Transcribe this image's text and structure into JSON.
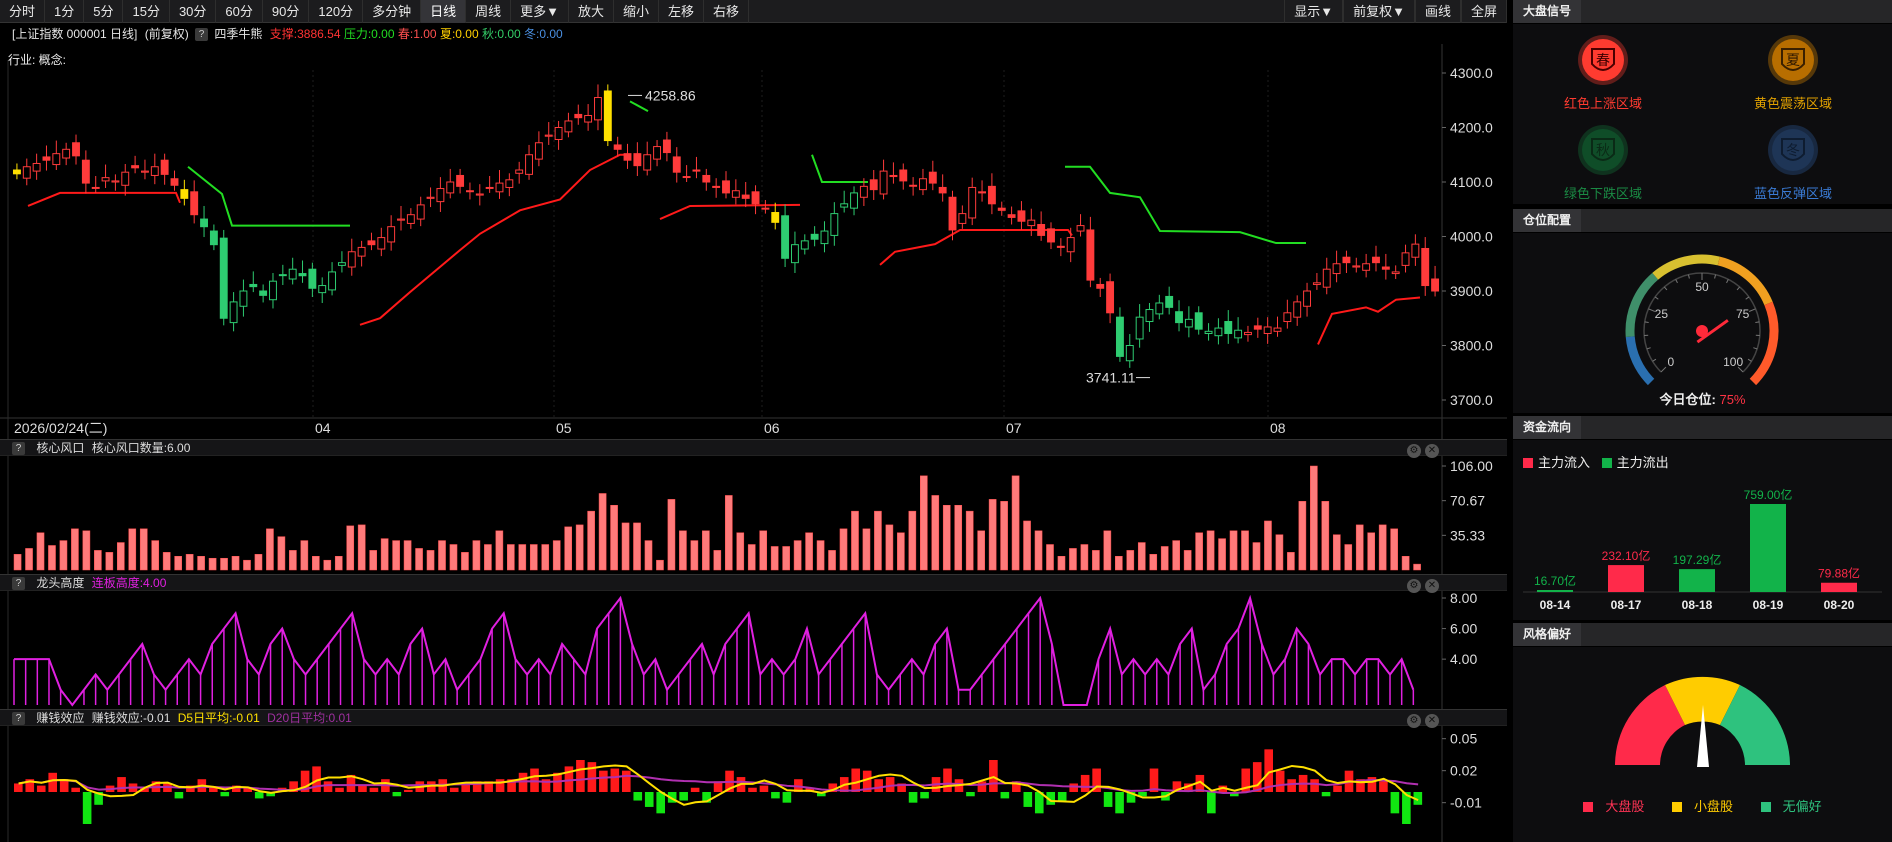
{
  "toolbar": {
    "left": [
      "分时",
      "1分",
      "5分",
      "15分",
      "30分",
      "60分",
      "90分",
      "120分",
      "多分钟",
      "日线",
      "周线",
      "更多▼",
      "放大",
      "缩小",
      "左移",
      "右移"
    ],
    "active_index": 9,
    "right": [
      "显示▼",
      "前复权▼",
      "画线",
      "全屏"
    ]
  },
  "info": {
    "instrument": "[上证指数 000001 日线]",
    "adjust": "(前复权)",
    "help": "?",
    "indicator": "四季牛熊",
    "support": "支撑:3886.54",
    "pressure": "压力:0.00",
    "spring": "春:1.00",
    "summer": "夏:0.00",
    "autumn": "秋:0.00",
    "winter": "冬:0.00",
    "industry": "行业: 概念:"
  },
  "main_chart": {
    "y_ticks": [
      "4300.0",
      "4200.0",
      "4100.0",
      "4000.0",
      "3900.0",
      "3800.0",
      "3700.0"
    ],
    "x_labels": [
      "2026/02/24(二)",
      "04",
      "05",
      "06",
      "07",
      "08"
    ],
    "high_label": "4258.86",
    "low_label": "3741.11"
  },
  "panels": {
    "core": {
      "title": "核心风口",
      "value": "核心风口数量:6.00",
      "ticks": [
        "106.00",
        "70.67",
        "35.33"
      ]
    },
    "dragon": {
      "title": "龙头高度",
      "value": "连板高度:4.00",
      "ticks": [
        "8.00",
        "6.00",
        "4.00"
      ]
    },
    "money": {
      "title": "赚钱效应",
      "value": "赚钱效应:-0.01",
      "d5": "D5日平均:-0.01",
      "d20": "D20日平均:0.01",
      "ticks": [
        "0.05",
        "0.02",
        "-0.01"
      ]
    }
  },
  "sidebar": {
    "market_signal": {
      "title": "大盘信号",
      "items": [
        {
          "glyph": "春",
          "label": "红色上涨区域",
          "color": "#ff3b30"
        },
        {
          "glyph": "夏",
          "label": "黄色震荡区域",
          "color": "#e08a00"
        },
        {
          "glyph": "秋",
          "label": "绿色下跌区域",
          "color": "#17a34a"
        },
        {
          "glyph": "冬",
          "label": "蓝色反弹区域",
          "color": "#3a7bd5"
        }
      ]
    },
    "position": {
      "title": "仓位配置",
      "ticks": [
        "0",
        "25",
        "50",
        "75",
        "100"
      ],
      "label": "今日仓位:",
      "value_text": "75%",
      "value": 75
    },
    "capital_flow": {
      "title": "资金流向",
      "legend_in": "主力流入",
      "legend_out": "主力流出",
      "bars": [
        {
          "date": "08-14",
          "value_label": "16.70亿",
          "value": 16.7,
          "dir": "out"
        },
        {
          "date": "08-17",
          "value_label": "232.10亿",
          "value": 232.1,
          "dir": "in"
        },
        {
          "date": "08-18",
          "value_label": "197.29亿",
          "value": 197.29,
          "dir": "out"
        },
        {
          "date": "08-19",
          "value_label": "759.00亿",
          "value": 759.0,
          "dir": "out"
        },
        {
          "date": "08-20",
          "value_label": "79.88亿",
          "value": 79.88,
          "dir": "in"
        }
      ]
    },
    "style": {
      "title": "风格偏好",
      "legend": [
        "大盘股",
        "小盘股",
        "无偏好"
      ]
    }
  },
  "colors": {
    "up": "#ff3b3b",
    "down": "#2ecc71",
    "support_line": "#ff1a1a",
    "resist_line": "#22dd22",
    "core_bar": "#ff6f6f",
    "dragon": "#e020e0",
    "money_up": "#ff1a1a",
    "money_down": "#11e611",
    "d5": "#ffe000",
    "d20": "#b030b0",
    "inflow": "#ff2a4a",
    "outflow": "#12b34a"
  }
}
